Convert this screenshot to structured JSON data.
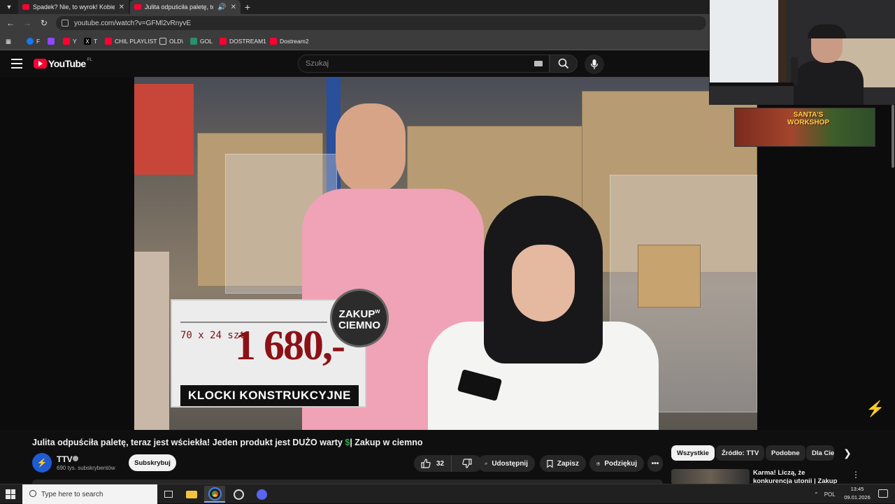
{
  "browser": {
    "tabs": [
      {
        "title": "Spadek? Nie, to wyrok! Kobieta"
      },
      {
        "title": "Julita odpuściła paletę, tera"
      }
    ],
    "url": "youtube.com/watch?v=GFMl2vRnyvE",
    "bookmarks": [
      "F",
      "",
      "Y",
      "T",
      "CHIL PLAYLIST",
      "OLD\\",
      "GOL",
      "DOSTREAM1",
      "Dostream2"
    ]
  },
  "youtube": {
    "logo_text": "YouTube",
    "country_code": "PL",
    "search_placeholder": "Szukaj"
  },
  "video_overlay": {
    "quantity_text": "70 x 24 szt.",
    "price_text": "1 680,-",
    "product_text": "KLOCKI KONSTRUKCYJNE",
    "badge_line1": "ZAKUP",
    "badge_w": "w",
    "badge_line2": "CIEMNO"
  },
  "banner_text": "SANTA'S WORKSHOP",
  "video": {
    "title_main": "Julita odpuściła paletę, teraz jest wściekła! Jeden produkt jest DUŻO warty ",
    "title_dollar": "$",
    "title_tail": "| Zakup w ciemno",
    "channel_name": "TTV",
    "channel_subs": "690 tys. subskrybentów",
    "subscribe_label": "Subskrybuj",
    "like_count": "32",
    "share_label": "Udostępnij",
    "save_label": "Zapisz",
    "thanks_label": "Podziękuj"
  },
  "chips": [
    "Wszystkie",
    "Źródło: TTV",
    "Podobne",
    "Dla Ciebie"
  ],
  "recommendation": {
    "title": "Karma! Liczą, że konkurencja utonii | Zakup w ciemno"
  },
  "taskbar": {
    "search_placeholder": "Type here to search",
    "language": "POL",
    "time": "13:45",
    "date": "09.01.2026"
  },
  "colors": {
    "youtube_red": "#ff0033",
    "dollar_green": "#26b04a",
    "price_red": "#8c1116"
  }
}
